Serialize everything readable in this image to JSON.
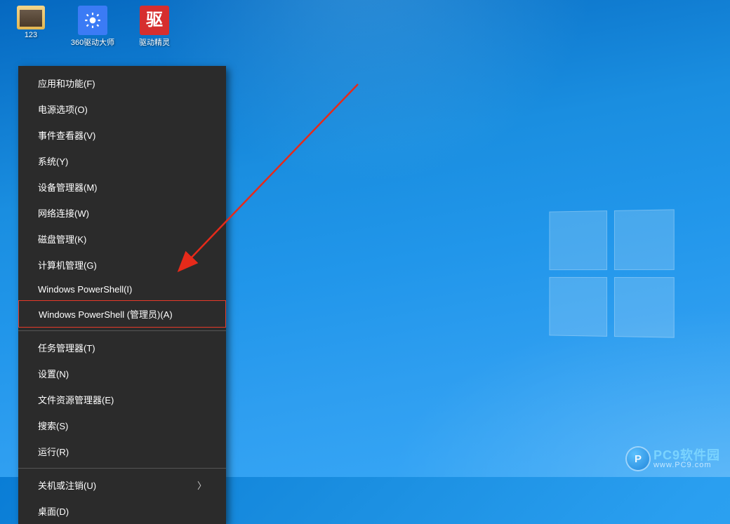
{
  "desktop_icons": [
    {
      "label": "123",
      "type": "folder"
    },
    {
      "label": "360驱动大师",
      "type": "gear"
    },
    {
      "label": "驱动精灵",
      "type": "red",
      "glyph": "驱"
    }
  ],
  "context_menu": {
    "groups": [
      [
        {
          "label": "应用和功能(F)"
        },
        {
          "label": "电源选项(O)"
        },
        {
          "label": "事件查看器(V)"
        },
        {
          "label": "系统(Y)"
        },
        {
          "label": "设备管理器(M)"
        },
        {
          "label": "网络连接(W)"
        },
        {
          "label": "磁盘管理(K)"
        },
        {
          "label": "计算机管理(G)"
        },
        {
          "label": "Windows PowerShell(I)"
        },
        {
          "label": "Windows PowerShell (管理员)(A)",
          "highlighted": true
        }
      ],
      [
        {
          "label": "任务管理器(T)"
        },
        {
          "label": "设置(N)"
        },
        {
          "label": "文件资源管理器(E)"
        },
        {
          "label": "搜索(S)"
        },
        {
          "label": "运行(R)"
        }
      ],
      [
        {
          "label": "关机或注销(U)",
          "submenu": true
        },
        {
          "label": "桌面(D)"
        }
      ]
    ]
  },
  "watermark": {
    "logo_letter": "P",
    "title": "PC9软件园",
    "url": "www.PC9.com"
  }
}
